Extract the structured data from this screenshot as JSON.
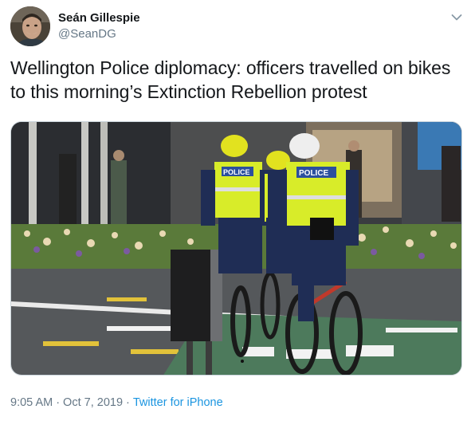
{
  "author": {
    "display_name": "Seán Gillespie",
    "handle": "@SeanDG",
    "avatar_icon": "profile-avatar"
  },
  "menu": {
    "icon": "chevron-down-icon"
  },
  "tweet": {
    "text": "Wellington Police diplomacy: officers travelled on bikes to this morning’s Extinction Rebellion protest",
    "vest_label": "POLICE"
  },
  "meta": {
    "time": "9:05 AM",
    "date": "Oct 7, 2019",
    "separator": "·",
    "source": "Twitter for iPhone"
  },
  "colors": {
    "link": "#1b95e0",
    "secondary_text": "#657786",
    "primary_text": "#14171a"
  }
}
